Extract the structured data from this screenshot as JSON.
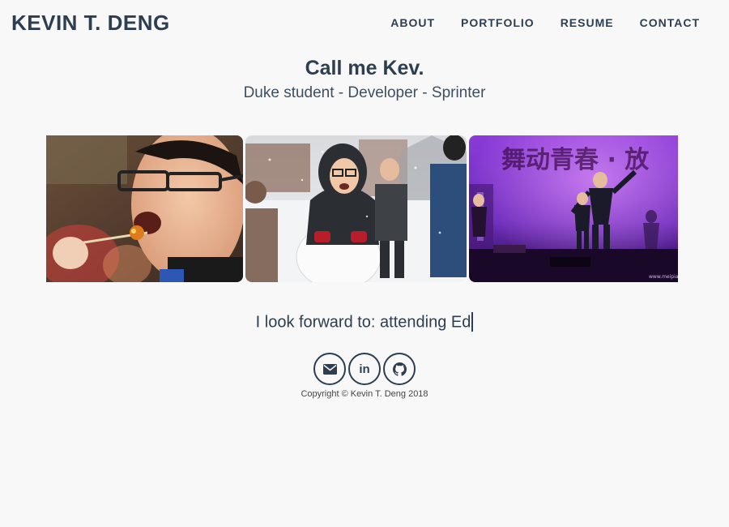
{
  "header": {
    "brand": "KEVIN T. DENG",
    "nav": [
      "ABOUT",
      "PORTFOLIO",
      "RESUME",
      "CONTACT"
    ]
  },
  "hero": {
    "headline": "Call me Kev.",
    "tagline": "Duke student - Developer - Sprinter"
  },
  "gallery": {
    "stage_banner_text": "舞动青春 · 放"
  },
  "typing": {
    "text": "I look forward to: attending Ed"
  },
  "social": {
    "linkedin_glyph": "in"
  },
  "footer": {
    "copyright": "Copyright © Kevin T. Deng 2018"
  },
  "colors": {
    "text": "#2c3e50",
    "background": "#f8f8f8"
  }
}
